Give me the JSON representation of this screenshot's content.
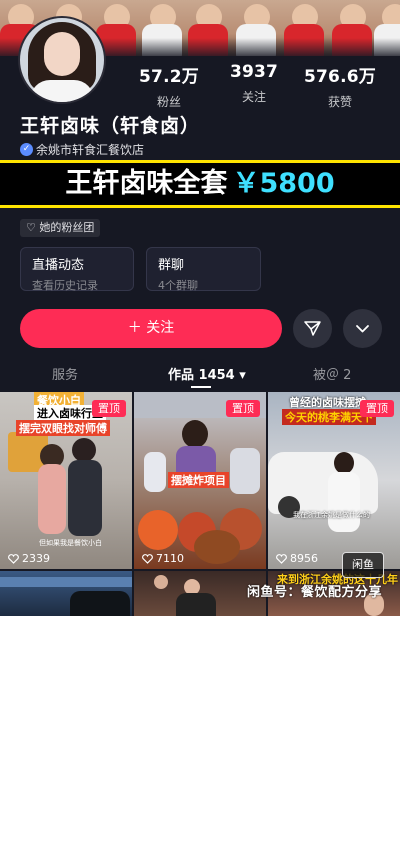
{
  "profile": {
    "name": "王轩卤味（轩食卤）",
    "verification_text": "余姚市轩食汇餐饮店"
  },
  "stats": [
    {
      "value": "57.2万",
      "label": "粉丝"
    },
    {
      "value": "3937",
      "label": "关注"
    },
    {
      "value": "576.6万",
      "label": "获赞"
    }
  ],
  "banner": {
    "main_text": "王轩卤味全套",
    "price_text": "￥5800"
  },
  "fan_club": {
    "label": "她的粉丝团"
  },
  "cards": [
    {
      "title": "直播动态",
      "subtitle": "查看历史记录"
    },
    {
      "title": "群聊",
      "subtitle": "4个群聊"
    }
  ],
  "actions": {
    "follow_label": "＋ 关注"
  },
  "tabs": [
    {
      "label": "服务"
    },
    {
      "label": "作品 1454 ▾"
    },
    {
      "label": "被＠ 2"
    }
  ],
  "videos": [
    {
      "pinned_label": "置顶",
      "likes": "2339",
      "captions": [
        "餐饮小白",
        "进入卤味行业",
        "摆完双眼找对师傅"
      ],
      "subtitle": "但如果我是餐饮小白"
    },
    {
      "pinned_label": "置顶",
      "likes": "7110",
      "captions": [
        "摆摊炸项目"
      ]
    },
    {
      "pinned_label": "置顶",
      "likes": "8956",
      "captions": [
        "曾经的卤味摆摊",
        "今天的桃李满天下"
      ],
      "subtitle": "我在浙江余姚是做什么的"
    },
    {
      "captions": []
    },
    {
      "captions": []
    },
    {
      "captions": [
        "来到浙江余姚的这十几年"
      ]
    }
  ],
  "overlay": {
    "watermark_text": "闲鱼",
    "bottom_text": "闲鱼号：餐饮配方分享"
  },
  "colors": {
    "background": "#161823",
    "accent": "#fe2c55",
    "banner_border": "#ffe400",
    "banner_price": "#3fe0ff"
  }
}
